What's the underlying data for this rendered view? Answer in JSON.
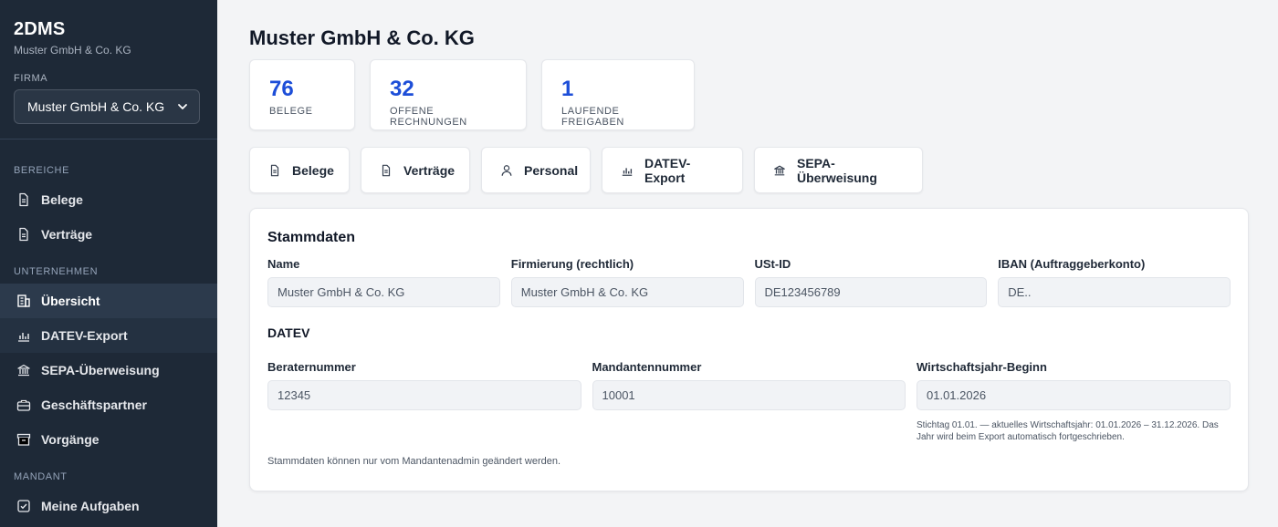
{
  "app": {
    "brand": "2DMS",
    "company_subtitle": "Muster GmbH & Co. KG"
  },
  "sidebar": {
    "firma_label": "FIRMA",
    "firma_selected": "Muster GmbH & Co. KG",
    "sections": {
      "bereiche": "BEREICHE",
      "unternehmen": "UNTERNEHMEN",
      "mandant": "MANDANT"
    },
    "items": [
      {
        "label": "Belege",
        "icon": "document-icon"
      },
      {
        "label": "Verträge",
        "icon": "document-icon"
      },
      {
        "label": "Übersicht",
        "icon": "building-icon",
        "active": true
      },
      {
        "label": "DATEV-Export",
        "icon": "bar-chart-icon"
      },
      {
        "label": "SEPA-Überweisung",
        "icon": "bank-icon"
      },
      {
        "label": "Geschäftspartner",
        "icon": "briefcase-icon"
      },
      {
        "label": "Vorgänge",
        "icon": "archive-icon"
      },
      {
        "label": "Meine Aufgaben",
        "icon": "checkbox-icon"
      }
    ]
  },
  "main": {
    "title": "Muster GmbH & Co. KG",
    "stats": [
      {
        "value": "76",
        "label": "BELEGE"
      },
      {
        "value": "32",
        "label": "OFFENE RECHNUNGEN"
      },
      {
        "value": "1",
        "label": "LAUFENDE FREIGABEN"
      }
    ],
    "quick_links": [
      {
        "label": "Belege",
        "icon": "document-icon"
      },
      {
        "label": "Verträge",
        "icon": "document-icon"
      },
      {
        "label": "Personal",
        "icon": "user-icon"
      },
      {
        "label": "DATEV-Export",
        "icon": "bar-chart-icon"
      },
      {
        "label": "SEPA-Überweisung",
        "icon": "bank-icon"
      }
    ],
    "stammdaten": {
      "title": "Stammdaten",
      "fields": [
        {
          "label": "Name",
          "value": "Muster GmbH & Co. KG"
        },
        {
          "label": "Firmierung (rechtlich)",
          "value": "Muster GmbH & Co. KG"
        },
        {
          "label": "USt-ID",
          "value": "DE123456789"
        },
        {
          "label": "IBAN (Auftraggeberkonto)",
          "value": "DE.."
        }
      ],
      "datev_title": "DATEV",
      "datev_fields": [
        {
          "label": "Beraternummer",
          "value": "12345"
        },
        {
          "label": "Mandantennummer",
          "value": "10001"
        },
        {
          "label": "Wirtschaftsjahr-Beginn",
          "value": "01.01.2026"
        }
      ],
      "wj_hint": "Stichtag 01.01. — aktuelles Wirtschaftsjahr: 01.01.2026 – 31.12.2026. Das Jahr wird beim Export automatisch fortgeschrieben.",
      "note": "Stammdaten können nur vom Mandantenadmin geändert werden."
    }
  },
  "colors": {
    "sidebar_bg": "#1e2937",
    "accent": "#1d4ed8",
    "page_bg": "#f3f4f6"
  }
}
